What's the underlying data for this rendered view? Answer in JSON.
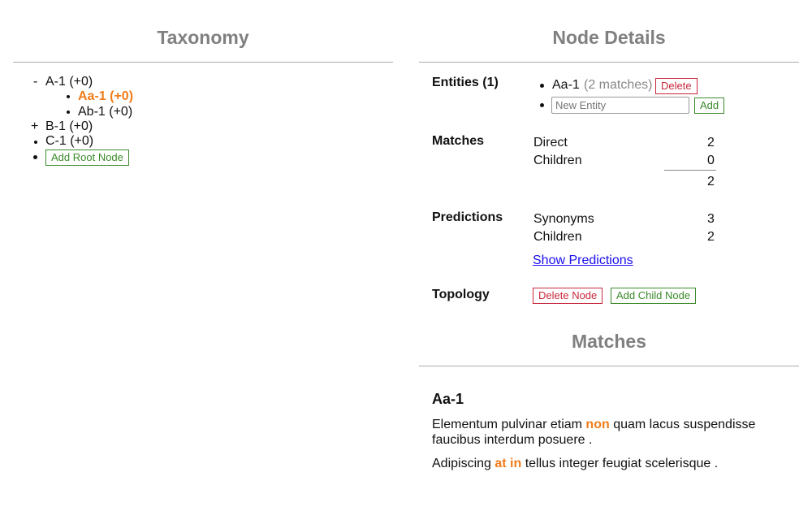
{
  "taxonomy": {
    "title": "Taxonomy",
    "tree": [
      {
        "toggle": "-",
        "label": "A-1 (+0)"
      },
      {
        "label": "Aa-1 (+0)",
        "selected": true
      },
      {
        "label": "Ab-1 (+0)"
      },
      {
        "toggle": "+",
        "label": "B-1 (+0)"
      },
      {
        "label": "C-1 (+0)"
      }
    ],
    "add_root": "Add Root Node"
  },
  "details": {
    "title": "Node Details",
    "entities_label": "Entities (1)",
    "entity": {
      "name": "Aa-1",
      "matches": "(2 matches)",
      "delete": "Delete"
    },
    "new_entity_placeholder": "New Entity",
    "add": "Add",
    "matches_label": "Matches",
    "direct_label": "Direct",
    "direct": "2",
    "children_label": "Children",
    "children": "0",
    "total": "2",
    "predictions_label": "Predictions",
    "synonyms_label": "Synonyms",
    "synonyms": "3",
    "pred_children_label": "Children",
    "pred_children": "2",
    "show_predictions": "Show Predictions",
    "topology_label": "Topology",
    "delete_node": "Delete Node",
    "add_child": "Add Child Node"
  },
  "matches": {
    "title": "Matches",
    "entity": "Aa-1",
    "p1": {
      "a": "Elementum pulvinar etiam ",
      "hl": "non",
      "b": " quam lacus suspendisse",
      "c": "faucibus interdum posuere ."
    },
    "p2": {
      "a": "Adipiscing ",
      "hl": "at in",
      "b": " tellus integer feugiat scelerisque ."
    }
  },
  "colors": {
    "accent": "#f07c1a",
    "danger": "#c8283c",
    "success": "#3a8a2a"
  }
}
